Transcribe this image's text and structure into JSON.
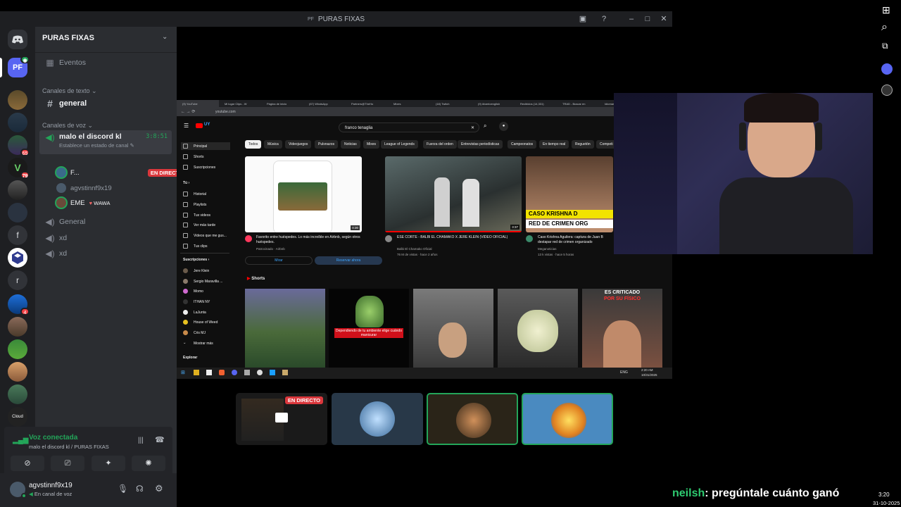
{
  "window": {
    "title": "PURAS FIXAS",
    "title_prefix": "PF"
  },
  "server": {
    "name": "PURAS FIXAS",
    "avatar_text": "PF"
  },
  "rail": {
    "badges": [
      "65",
      "79",
      "4"
    ],
    "letters": [
      "f",
      "r"
    ],
    "cloud_label": "Cloud"
  },
  "sidebar": {
    "events_label": "Eventos",
    "text_category": "Canales de texto",
    "text_channels": [
      "general"
    ],
    "voice_category": "Canales de voz",
    "active_voice": {
      "name": "malo el discord kl",
      "timer": "3:8:51",
      "status_placeholder": "Establece un estado de canal",
      "users": [
        {
          "name": "F...",
          "tag": "EN DIRECTO"
        },
        {
          "name": "agvstinnf9x19",
          "tag": ""
        },
        {
          "name": "EME",
          "tag": "WAWA"
        }
      ]
    },
    "voice_channels": [
      "General",
      "xd",
      "xd"
    ]
  },
  "voice_panel": {
    "status": "Voz conectada",
    "location": "malo el discord kl / PURAS FIXAS"
  },
  "user_panel": {
    "username": "agvstinnf9x19",
    "status": "En canal de voz"
  },
  "stream": {
    "browser_tabs": [
      "(9) YouTube",
      "Mi lugar Clips - W",
      "Página de inicio",
      "(67) WhatsApp",
      "Partners@TheHo",
      "Mixes",
      "(18) Twitch",
      "(9) #barrioenglish",
      "Recibidos (14,331)",
      "TRAD - Buscar en",
      "Idiomas más hab"
    ],
    "url": "youtube.com",
    "search_query": "franco tenaglia",
    "chips": [
      "Todos",
      "Música",
      "Videojuegos",
      "Pulsnazos",
      "Noticias",
      "Mixes",
      "League of Legends",
      "Fuerza del orden",
      "Entrevistas periodísticas",
      "Campeonatos",
      "En tiempo real",
      "Reguetón",
      "Competi"
    ],
    "nav_main": [
      "Principal",
      "Shorts",
      "Suscripciones"
    ],
    "nav_you_header": "Tú",
    "nav_you": [
      "Historial",
      "Playlists",
      "Tus videos",
      "Ver más tarde",
      "Videos que me gus...",
      "Tus clips"
    ],
    "subs_header": "Suscripciones",
    "subs": [
      "Jere Klein",
      "Sergio Maravilla ...",
      "Momo",
      "ITHAN NY",
      "LaJunta",
      "House of Weed",
      "Cris MJ",
      "Mostrar más"
    ],
    "explore_header": "Explorar",
    "videos": [
      {
        "title": "Favorito entre huéspedes. Lo más increíble en Airbnb, según otros huéspedes.",
        "channel": "Patrocinado · Airbnb",
        "meta": "",
        "duration": "0:30"
      },
      {
        "title": "ESE CORTE - BALBI EL CHAMAKO X JERE KLEIN (VIDEO OFICIAL)",
        "channel": "Balbi El Chamako Oficial",
        "meta": "76 M de vistas · hace 2 años",
        "duration": "3:37"
      },
      {
        "title": "Caso Krishna Aguilera: captura de Juan B destapar red de crimen organizado",
        "channel": "Meganoticias",
        "meta": "13 k vistas · hace 5 horas",
        "duration": ""
      }
    ],
    "ad_buttons": [
      "Mirar",
      "Reservar ahora"
    ],
    "thumb_overlay": [
      "CASO KRISHNA D",
      "RED DE CRIMEN ORG"
    ],
    "shorts_header": "Shorts",
    "shorts_overlays": [
      "Dependiendo de tu ambiente elige cuándo manicurar",
      "ES CRITICADO",
      "POR SU FÍSICO"
    ],
    "taskbar_time": "2:20 AM",
    "taskbar_date": "10/31/2025",
    "taskbar_lang": "ENG"
  },
  "tiles": {
    "live_badge": "EN DIRECTO"
  },
  "chat": {
    "user": "neilsh",
    "message": ": pregúntale cuánto ganó"
  },
  "system_clock": {
    "time": "3:20",
    "date": "31-10-2025"
  },
  "colors": {
    "accent": "#5865f2",
    "live": "#da373c",
    "online": "#23a559",
    "speaking_ring": "#23a559",
    "yt_red": "#ff0000",
    "chat_user": "#2ecc71"
  }
}
